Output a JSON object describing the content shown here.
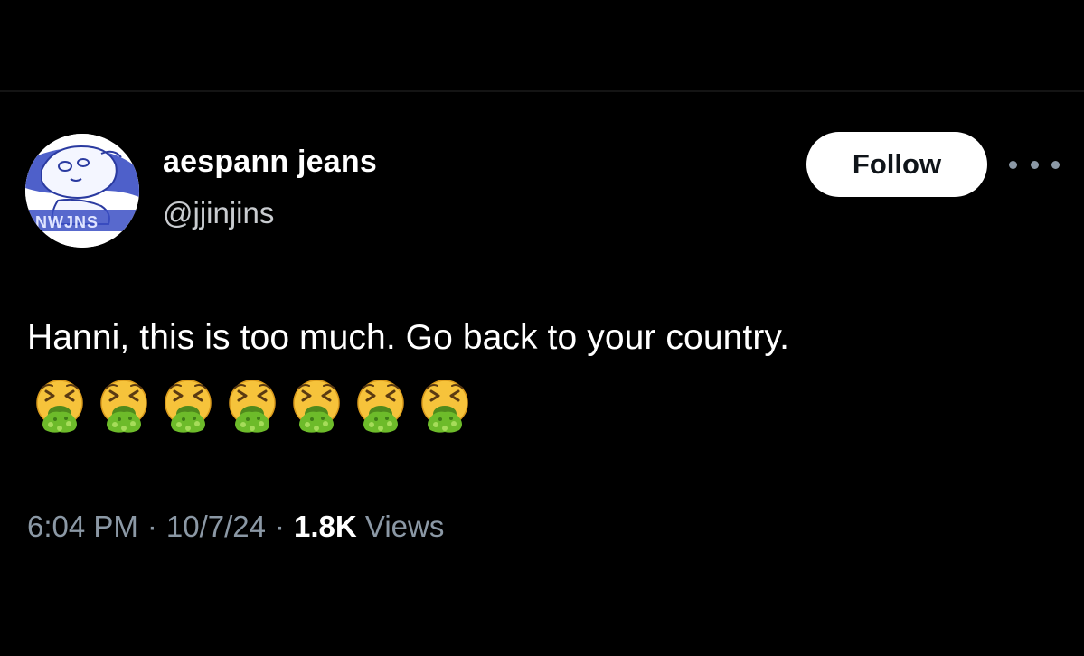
{
  "author": {
    "display_name": "aespann jeans",
    "handle": "@jjinjins",
    "avatar_banner_text": "NWJNS"
  },
  "actions": {
    "follow_label": "Follow",
    "more_icon": "more-horizontal-icon"
  },
  "tweet": {
    "text": "Hanni, this is too much. Go back to your country.",
    "emoji_name": "face-vomiting-emoji",
    "emoji_count": 7
  },
  "meta": {
    "time": "6:04 PM",
    "separator": "·",
    "date": "10/7/24",
    "views_count": "1.8K",
    "views_label": "Views"
  },
  "colors": {
    "background": "#000000",
    "primary_text": "#ffffff",
    "secondary_text": "#8b98a5",
    "follow_button_bg": "#ffffff",
    "follow_button_text": "#0f1419",
    "avatar_accent": "#3b4fc4"
  }
}
